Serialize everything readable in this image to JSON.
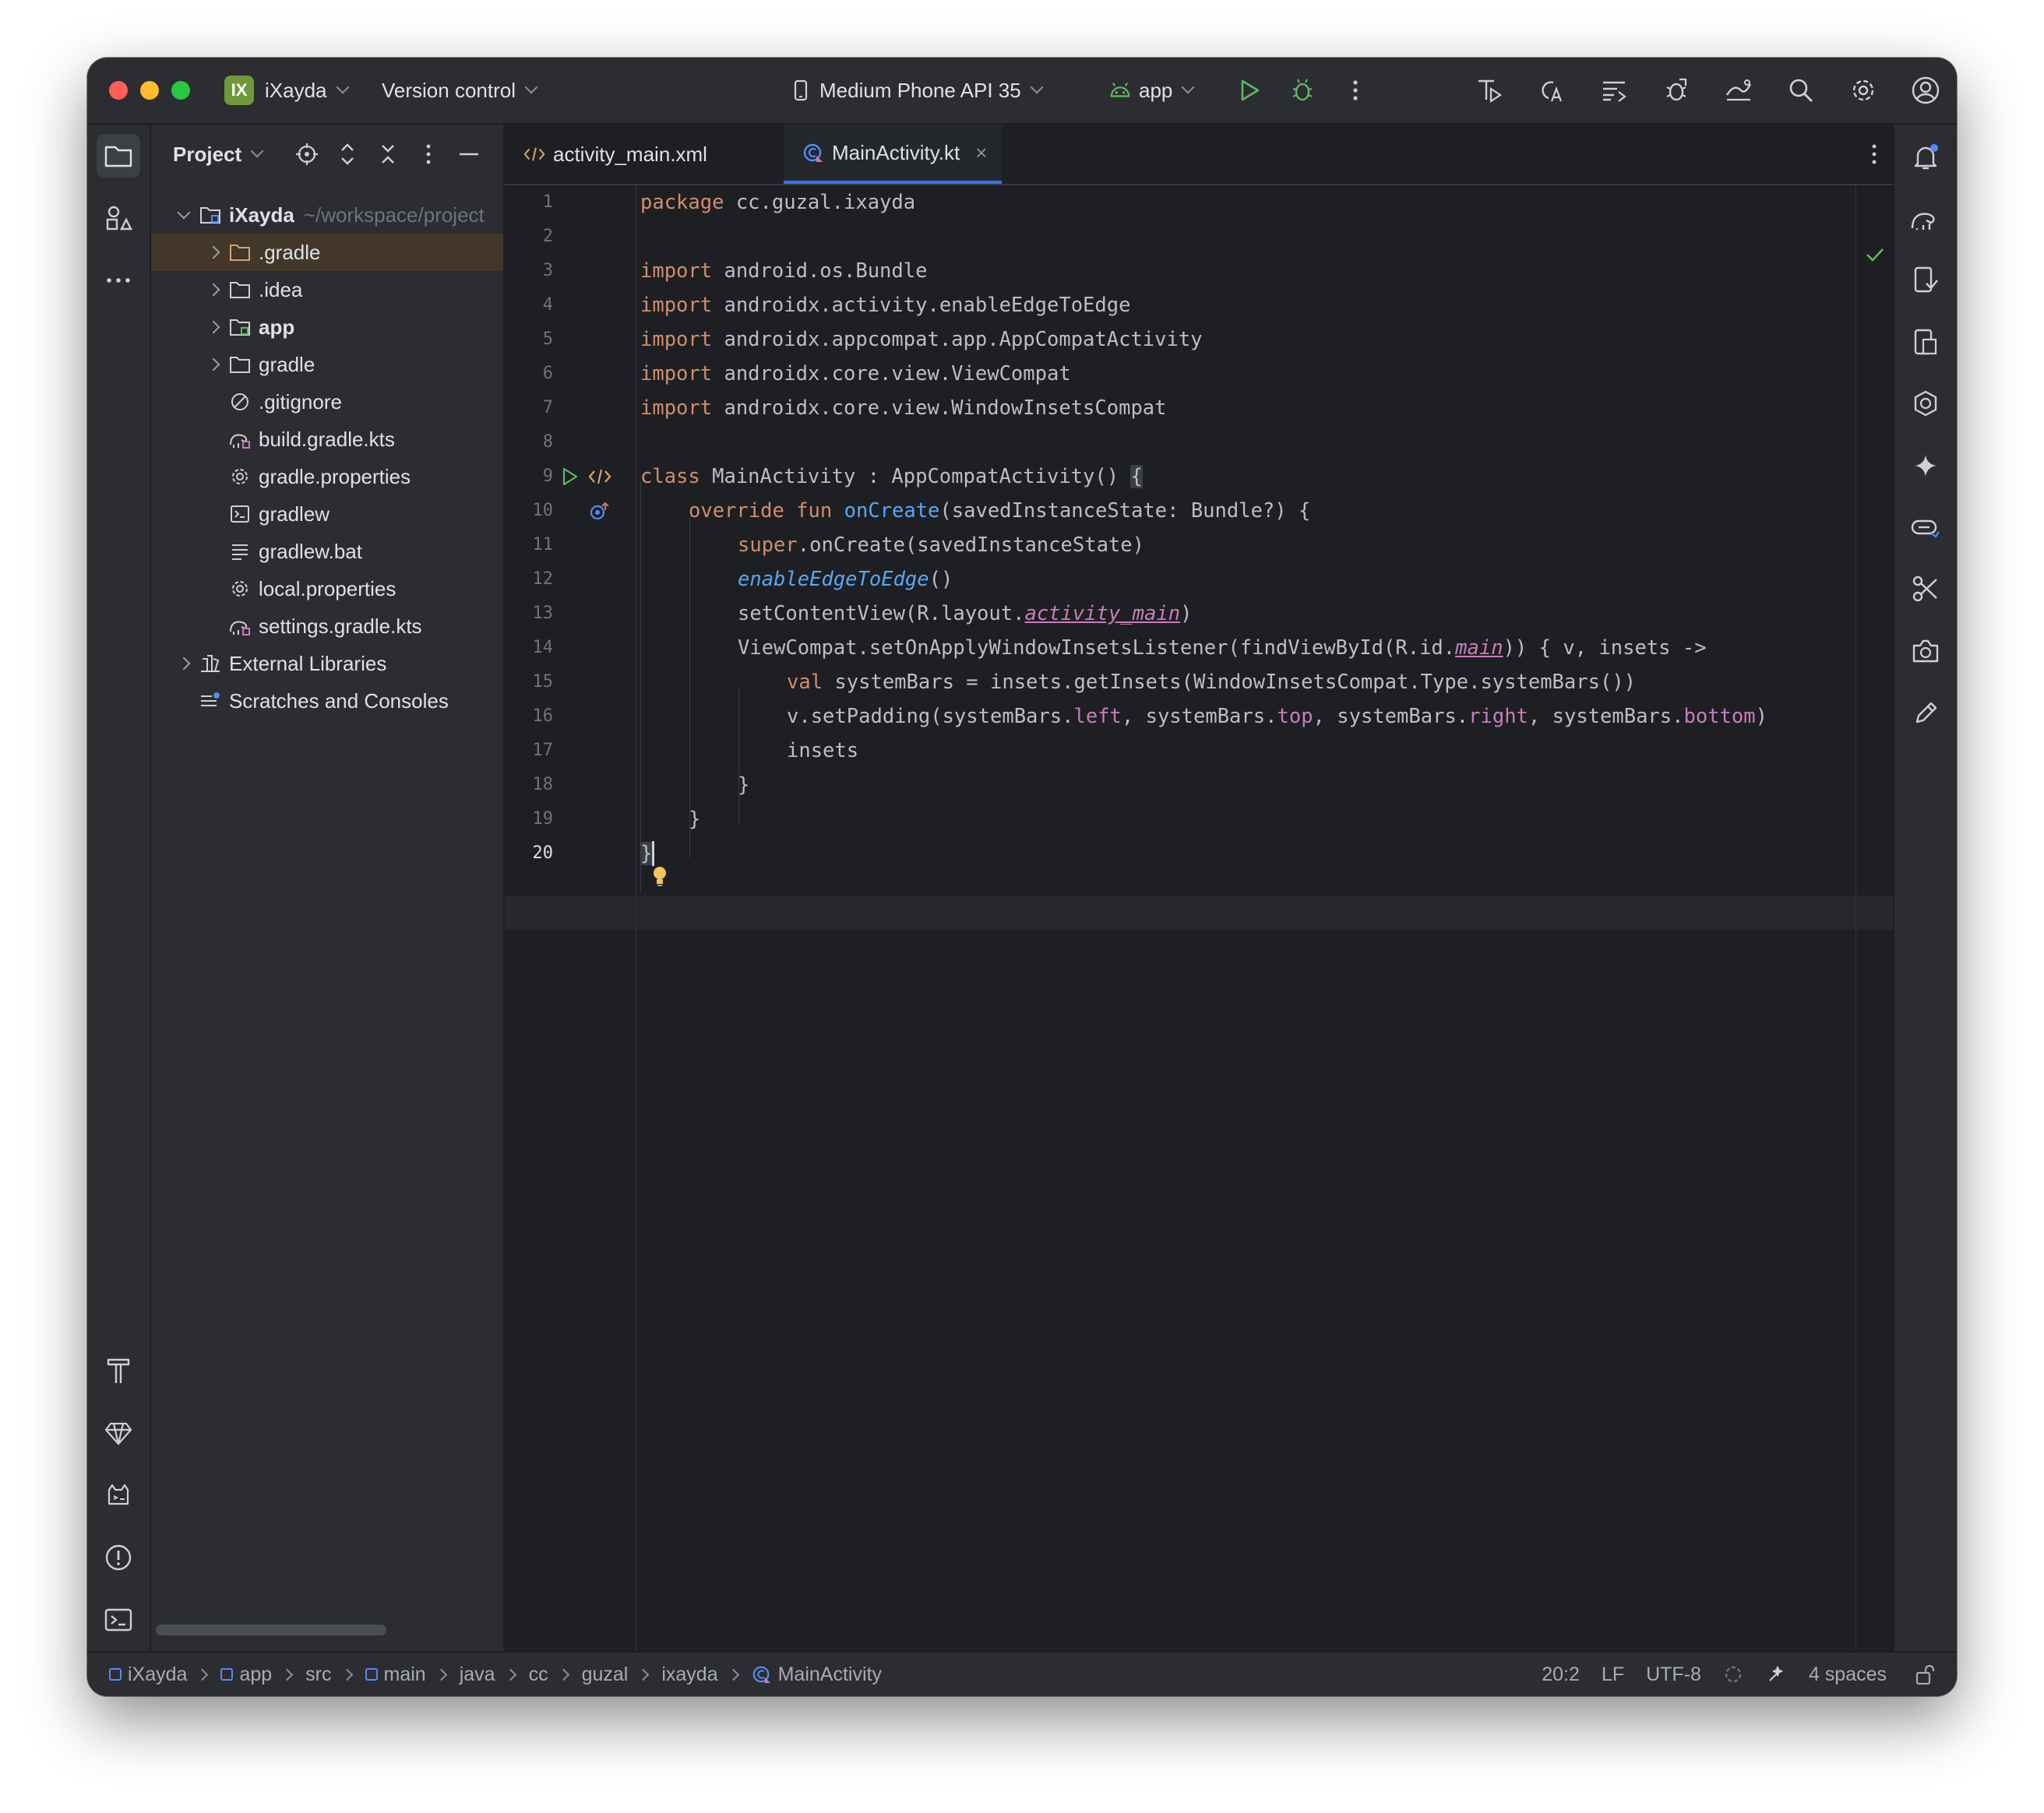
{
  "titlebar": {
    "project_badge": "IX",
    "project_name": "iXayda",
    "vcs": "Version control",
    "device": "Medium Phone API 35",
    "run_config": "app"
  },
  "project_panel": {
    "title": "Project",
    "root_name": "iXayda",
    "root_path": "~/workspace/project",
    "items": [
      {
        "label": ".gradle",
        "kind": "folder"
      },
      {
        "label": ".idea",
        "kind": "folder"
      },
      {
        "label": "app",
        "kind": "module"
      },
      {
        "label": "gradle",
        "kind": "folder"
      },
      {
        "label": ".gitignore",
        "kind": "ignore"
      },
      {
        "label": "build.gradle.kts",
        "kind": "gradle"
      },
      {
        "label": "gradle.properties",
        "kind": "properties"
      },
      {
        "label": "gradlew",
        "kind": "script"
      },
      {
        "label": "gradlew.bat",
        "kind": "text"
      },
      {
        "label": "local.properties",
        "kind": "properties"
      },
      {
        "label": "settings.gradle.kts",
        "kind": "gradle"
      }
    ],
    "external_libraries": "External Libraries",
    "scratches": "Scratches and Consoles"
  },
  "tabs": [
    {
      "label": "activity_main.xml",
      "active": false
    },
    {
      "label": "MainActivity.kt",
      "active": true
    }
  ],
  "code_lines": [
    "1",
    "2",
    "3",
    "4",
    "5",
    "6",
    "7",
    "8",
    "9",
    "10",
    "11",
    "12",
    "13",
    "14",
    "15",
    "16",
    "17",
    "18",
    "19",
    "20"
  ],
  "code": {
    "l1a": "package",
    "l1b": " cc.guzal.ixayda",
    "import": "import",
    "l3": " android.os.Bundle",
    "l4": " androidx.activity.enableEdgeToEdge",
    "l5": " androidx.appcompat.app.AppCompatActivity",
    "l6": " androidx.core.view.ViewCompat",
    "l7": " androidx.core.view.WindowInsetsCompat",
    "l9a": "class",
    "l9b": " MainActivity : AppCompatActivity() ",
    "l9c": "{",
    "l10a": "override fun ",
    "l10b": "onCreate",
    "l10c": "(savedInstanceState: Bundle?) {",
    "l11a": "super",
    "l11b": ".onCreate(savedInstanceState)",
    "l12a": "enableEdgeToEdge",
    "l12b": "()",
    "l13a": "setContentView(R.layout.",
    "l13b": "activity_main",
    "l13c": ")",
    "l14a": "ViewCompat.setOnApplyWindowInsetsListener(findViewById(R.id.",
    "l14b": "main",
    "l14c": ")) { v, insets ->",
    "l15a": "val",
    "l15b": " systemBars = insets.getInsets(WindowInsetsCompat.Type.systemBars())",
    "l16a": "v.setPadding(systemBars.",
    "l16b": "left",
    "l16c": ", systemBars.",
    "l16d": "top",
    "l16e": ", systemBars.",
    "l16f": "right",
    "l16g": ", systemBars.",
    "l16h": "bottom",
    "l16i": ")",
    "l17": "insets",
    "l18": "}",
    "l19": "}",
    "l20": "}"
  },
  "statusbar": {
    "breadcrumbs": [
      "iXayda",
      "app",
      "src",
      "main",
      "java",
      "cc",
      "guzal",
      "ixayda",
      "MainActivity"
    ],
    "position": "20:2",
    "line_sep": "LF",
    "encoding": "UTF-8",
    "indent": "4 spaces"
  },
  "colors": {
    "keyword": "#cf8e6d",
    "function": "#56a8f5",
    "property": "#c77dbb",
    "accent": "#3574f0"
  }
}
